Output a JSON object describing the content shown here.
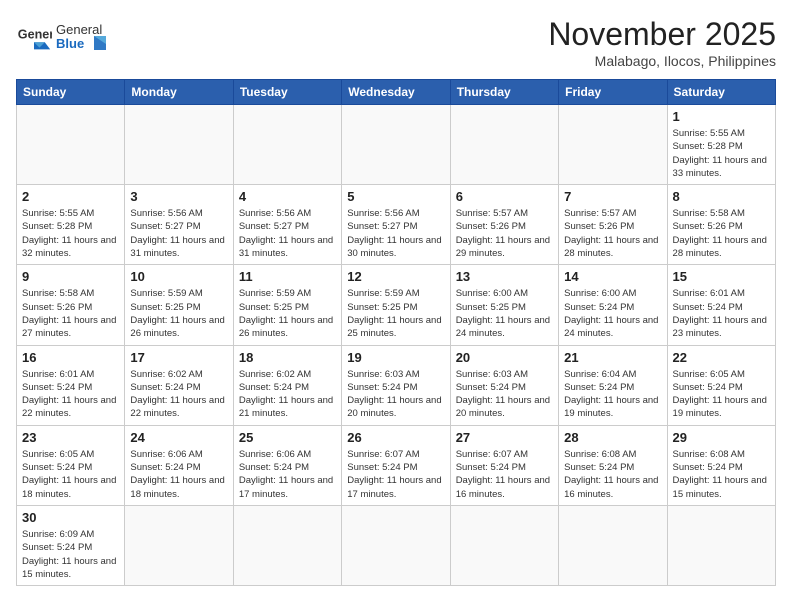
{
  "header": {
    "logo_general": "General",
    "logo_blue": "Blue",
    "month_title": "November 2025",
    "location": "Malabago, Ilocos, Philippines"
  },
  "weekdays": [
    "Sunday",
    "Monday",
    "Tuesday",
    "Wednesday",
    "Thursday",
    "Friday",
    "Saturday"
  ],
  "days": [
    {
      "date": null,
      "num": "",
      "sunrise": "",
      "sunset": "",
      "daylight": ""
    },
    {
      "date": null,
      "num": "",
      "sunrise": "",
      "sunset": "",
      "daylight": ""
    },
    {
      "date": null,
      "num": "",
      "sunrise": "",
      "sunset": "",
      "daylight": ""
    },
    {
      "date": null,
      "num": "",
      "sunrise": "",
      "sunset": "",
      "daylight": ""
    },
    {
      "date": null,
      "num": "",
      "sunrise": "",
      "sunset": "",
      "daylight": ""
    },
    {
      "date": null,
      "num": "",
      "sunrise": "",
      "sunset": "",
      "daylight": ""
    },
    {
      "date": 1,
      "num": "1",
      "sunrise": "Sunrise: 5:55 AM",
      "sunset": "Sunset: 5:28 PM",
      "daylight": "Daylight: 11 hours and 33 minutes."
    },
    {
      "date": 2,
      "num": "2",
      "sunrise": "Sunrise: 5:55 AM",
      "sunset": "Sunset: 5:28 PM",
      "daylight": "Daylight: 11 hours and 32 minutes."
    },
    {
      "date": 3,
      "num": "3",
      "sunrise": "Sunrise: 5:56 AM",
      "sunset": "Sunset: 5:27 PM",
      "daylight": "Daylight: 11 hours and 31 minutes."
    },
    {
      "date": 4,
      "num": "4",
      "sunrise": "Sunrise: 5:56 AM",
      "sunset": "Sunset: 5:27 PM",
      "daylight": "Daylight: 11 hours and 31 minutes."
    },
    {
      "date": 5,
      "num": "5",
      "sunrise": "Sunrise: 5:56 AM",
      "sunset": "Sunset: 5:27 PM",
      "daylight": "Daylight: 11 hours and 30 minutes."
    },
    {
      "date": 6,
      "num": "6",
      "sunrise": "Sunrise: 5:57 AM",
      "sunset": "Sunset: 5:26 PM",
      "daylight": "Daylight: 11 hours and 29 minutes."
    },
    {
      "date": 7,
      "num": "7",
      "sunrise": "Sunrise: 5:57 AM",
      "sunset": "Sunset: 5:26 PM",
      "daylight": "Daylight: 11 hours and 28 minutes."
    },
    {
      "date": 8,
      "num": "8",
      "sunrise": "Sunrise: 5:58 AM",
      "sunset": "Sunset: 5:26 PM",
      "daylight": "Daylight: 11 hours and 28 minutes."
    },
    {
      "date": 9,
      "num": "9",
      "sunrise": "Sunrise: 5:58 AM",
      "sunset": "Sunset: 5:26 PM",
      "daylight": "Daylight: 11 hours and 27 minutes."
    },
    {
      "date": 10,
      "num": "10",
      "sunrise": "Sunrise: 5:59 AM",
      "sunset": "Sunset: 5:25 PM",
      "daylight": "Daylight: 11 hours and 26 minutes."
    },
    {
      "date": 11,
      "num": "11",
      "sunrise": "Sunrise: 5:59 AM",
      "sunset": "Sunset: 5:25 PM",
      "daylight": "Daylight: 11 hours and 26 minutes."
    },
    {
      "date": 12,
      "num": "12",
      "sunrise": "Sunrise: 5:59 AM",
      "sunset": "Sunset: 5:25 PM",
      "daylight": "Daylight: 11 hours and 25 minutes."
    },
    {
      "date": 13,
      "num": "13",
      "sunrise": "Sunrise: 6:00 AM",
      "sunset": "Sunset: 5:25 PM",
      "daylight": "Daylight: 11 hours and 24 minutes."
    },
    {
      "date": 14,
      "num": "14",
      "sunrise": "Sunrise: 6:00 AM",
      "sunset": "Sunset: 5:24 PM",
      "daylight": "Daylight: 11 hours and 24 minutes."
    },
    {
      "date": 15,
      "num": "15",
      "sunrise": "Sunrise: 6:01 AM",
      "sunset": "Sunset: 5:24 PM",
      "daylight": "Daylight: 11 hours and 23 minutes."
    },
    {
      "date": 16,
      "num": "16",
      "sunrise": "Sunrise: 6:01 AM",
      "sunset": "Sunset: 5:24 PM",
      "daylight": "Daylight: 11 hours and 22 minutes."
    },
    {
      "date": 17,
      "num": "17",
      "sunrise": "Sunrise: 6:02 AM",
      "sunset": "Sunset: 5:24 PM",
      "daylight": "Daylight: 11 hours and 22 minutes."
    },
    {
      "date": 18,
      "num": "18",
      "sunrise": "Sunrise: 6:02 AM",
      "sunset": "Sunset: 5:24 PM",
      "daylight": "Daylight: 11 hours and 21 minutes."
    },
    {
      "date": 19,
      "num": "19",
      "sunrise": "Sunrise: 6:03 AM",
      "sunset": "Sunset: 5:24 PM",
      "daylight": "Daylight: 11 hours and 20 minutes."
    },
    {
      "date": 20,
      "num": "20",
      "sunrise": "Sunrise: 6:03 AM",
      "sunset": "Sunset: 5:24 PM",
      "daylight": "Daylight: 11 hours and 20 minutes."
    },
    {
      "date": 21,
      "num": "21",
      "sunrise": "Sunrise: 6:04 AM",
      "sunset": "Sunset: 5:24 PM",
      "daylight": "Daylight: 11 hours and 19 minutes."
    },
    {
      "date": 22,
      "num": "22",
      "sunrise": "Sunrise: 6:05 AM",
      "sunset": "Sunset: 5:24 PM",
      "daylight": "Daylight: 11 hours and 19 minutes."
    },
    {
      "date": 23,
      "num": "23",
      "sunrise": "Sunrise: 6:05 AM",
      "sunset": "Sunset: 5:24 PM",
      "daylight": "Daylight: 11 hours and 18 minutes."
    },
    {
      "date": 24,
      "num": "24",
      "sunrise": "Sunrise: 6:06 AM",
      "sunset": "Sunset: 5:24 PM",
      "daylight": "Daylight: 11 hours and 18 minutes."
    },
    {
      "date": 25,
      "num": "25",
      "sunrise": "Sunrise: 6:06 AM",
      "sunset": "Sunset: 5:24 PM",
      "daylight": "Daylight: 11 hours and 17 minutes."
    },
    {
      "date": 26,
      "num": "26",
      "sunrise": "Sunrise: 6:07 AM",
      "sunset": "Sunset: 5:24 PM",
      "daylight": "Daylight: 11 hours and 17 minutes."
    },
    {
      "date": 27,
      "num": "27",
      "sunrise": "Sunrise: 6:07 AM",
      "sunset": "Sunset: 5:24 PM",
      "daylight": "Daylight: 11 hours and 16 minutes."
    },
    {
      "date": 28,
      "num": "28",
      "sunrise": "Sunrise: 6:08 AM",
      "sunset": "Sunset: 5:24 PM",
      "daylight": "Daylight: 11 hours and 16 minutes."
    },
    {
      "date": 29,
      "num": "29",
      "sunrise": "Sunrise: 6:08 AM",
      "sunset": "Sunset: 5:24 PM",
      "daylight": "Daylight: 11 hours and 15 minutes."
    },
    {
      "date": 30,
      "num": "30",
      "sunrise": "Sunrise: 6:09 AM",
      "sunset": "Sunset: 5:24 PM",
      "daylight": "Daylight: 11 hours and 15 minutes."
    }
  ]
}
